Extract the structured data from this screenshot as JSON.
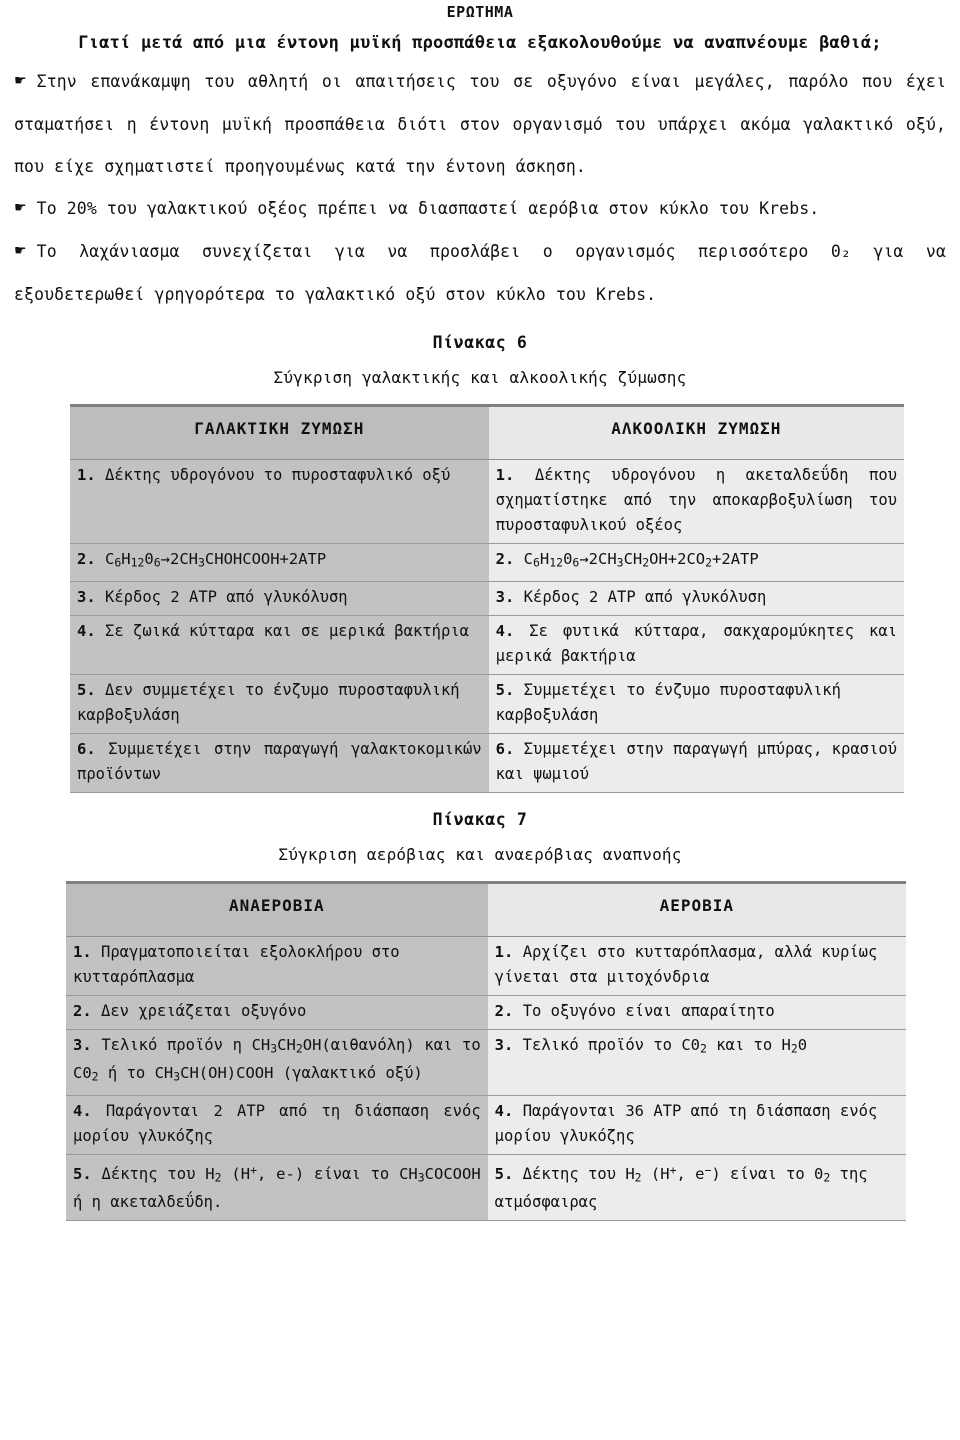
{
  "heading": {
    "label": "ΕΡΩΤΗΜΑ",
    "question": "Γιατί μετά από μια έντονη μυϊκή προσπάθεια εξακολουθούμε να αναπνέουμε βαθιά;"
  },
  "bullet_glyph": "☛",
  "paragraphs": [
    "Στην επανάκαμψη του αθλητή οι απαιτήσεις του σε οξυγόνο είναι μεγάλες, παρόλο που έχει σταματήσει η έντονη μυϊκή προσπάθεια διότι στον οργανισμό του υπάρχει ακόμα γαλακτικό οξύ, που είχε σχηματιστεί προηγουμένως κατά την έντονη άσκηση.",
    "Το 20% του γαλακτικού οξέος πρέπει να διασπαστεί αερόβια στον κύκλο του Krebs.",
    "Το λαχάνιασμα συνεχίζεται για να προσλάβει ο οργανισμός περισσότερο 0₂ για να εξουδετερωθεί γρηγορότερα το γαλακτικό οξύ στον κύκλο του Krebs."
  ],
  "table6": {
    "number": "Πίνακας 6",
    "caption": "Σύγκριση γαλακτικής και αλκοολικής ζύμωσης",
    "headers": [
      "ΓΑΛΑΚΤΙΚΗ ΖΥΜΩΣΗ",
      "ΑΛΚΟΟΛΙΚΗ ΖΥΜΩΣΗ"
    ],
    "rows": [
      {
        "n": "1.",
        "left": "Δέκτης υδρογόνου το πυροσταφυλικό οξύ",
        "right": "Δέκτης υδρογόνου η ακεταλδεΰδη που σχηματίστηκε από την αποκαρβοξυλίωση του πυροσταφυλικού οξέος"
      },
      {
        "n": "2.",
        "left": "C6H1206→2CH3CHOHCOOH+2ATP",
        "right": "C6H1206→2CH3CH2OH+2CO2+2ATP"
      },
      {
        "n": "3.",
        "left": "Κέρδος 2 ΑΤΡ από γλυκόλυση",
        "right": "Κέρδος 2 ΑΤΡ από γλυκόλυση"
      },
      {
        "n": "4.",
        "left": "Σε ζωικά κύτταρα και σε μερικά βακτήρια",
        "right": "Σε φυτικά κύτταρα, σακχαρομύκητες και μερικά βακτήρια"
      },
      {
        "n": "5.",
        "left": "Δεν συμμετέχει το ένζυμο πυροσταφυλική καρβοξυλάση",
        "right": "Συμμετέχει το ένζυμο πυροσταφυλική καρβοξυλάση"
      },
      {
        "n": "6.",
        "left": "Συμμετέχει στην παραγωγή γαλακτοκομικών προϊόντων",
        "right": "Συμμετέχει στην παραγωγή μπύρας, κρασιού και ψωμιού"
      }
    ]
  },
  "table7": {
    "number": "Πίνακας 7",
    "caption": "Σύγκριση αερόβιας και αναερόβιας αναπνοής",
    "headers": [
      "ΑΝΑΕΡΟΒΙΑ",
      "ΑΕΡΟΒΙΑ"
    ],
    "rows": [
      {
        "n": "1.",
        "left": "Πραγματοποιείται εξολοκλήρου στο κυτταρόπλασμα",
        "right": "Αρχίζει στο κυτταρόπλασμα, αλλά κυρίως γίνεται στα μιτοχόνδρια"
      },
      {
        "n": "2.",
        "left": "Δεν χρειάζεται οξυγόνο",
        "right": "Το οξυγόνο είναι απαραίτητο"
      },
      {
        "n": "3.",
        "left": "Τελικό προϊόν η CH3CH2OH(αιθανόλη) και το C02 ή το CH3CH(OH)COOH (γαλακτικό οξύ)",
        "right": "Τελικό προϊόν το C02 και το H20"
      },
      {
        "n": "4.",
        "left": "Παράγονται 2 ΑΤΡ από τη διάσπαση ενός μορίου γλυκόζης",
        "right": "Παράγονται 36 ΑΤΡ από τη διάσπαση ενός μορίου γλυκόζης"
      },
      {
        "n": "5.",
        "left": "Δέκτης του H2 (H+, e-) είναι το CH3COCOOH ή η ακεταλδεΰδη.",
        "right": "Δέκτης του H2 (H+, e−) είναι το 02 της ατμόσφαιρας"
      }
    ]
  },
  "colors": {
    "col_left_header": "#bdbdbd",
    "col_right_header": "#e8e8e8",
    "col_left_body": "#c2c2c2",
    "col_right_body": "#ececec",
    "border": "#808080",
    "text": "#111111"
  }
}
